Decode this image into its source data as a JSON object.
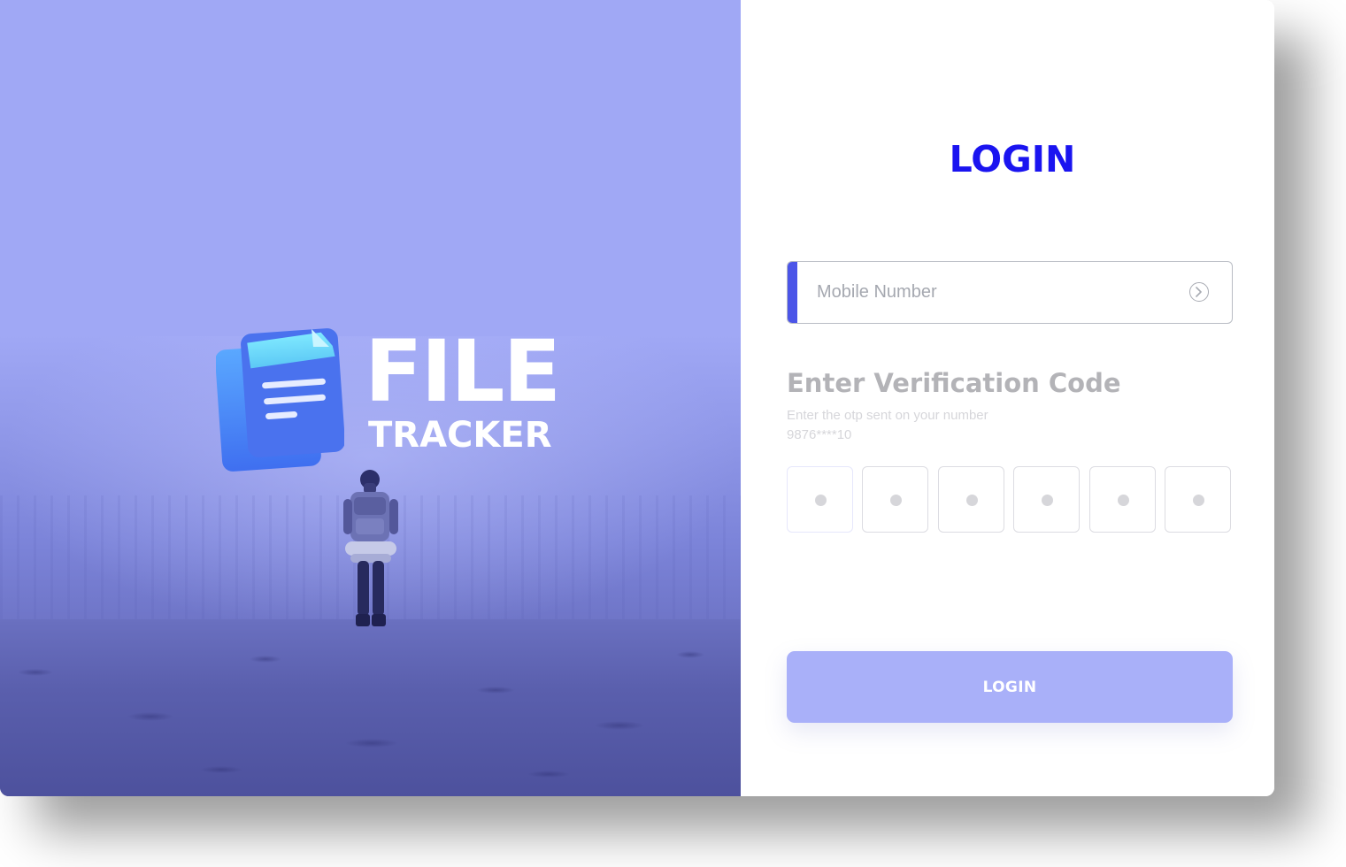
{
  "brand": {
    "word_primary": "FILE",
    "word_secondary": "TRACKER",
    "icon": "document-stack-icon"
  },
  "hero": {
    "background_color": "#a0a8f5",
    "illustration": "hiker-in-fog"
  },
  "login": {
    "title": "LOGIN",
    "title_color": "#1a14f0",
    "mobile": {
      "placeholder": "Mobile Number",
      "value": "",
      "submit_icon": "arrow-right-circle-icon",
      "accent_color": "#4b55e8"
    },
    "otp": {
      "heading": "Enter Verification Code",
      "subtitle": "Enter the otp sent on your number",
      "masked_number": "9876****10",
      "digits": [
        "",
        "",
        "",
        "",
        "",
        ""
      ]
    },
    "button": {
      "label": "LOGIN",
      "color": "#a9b0f9"
    }
  }
}
